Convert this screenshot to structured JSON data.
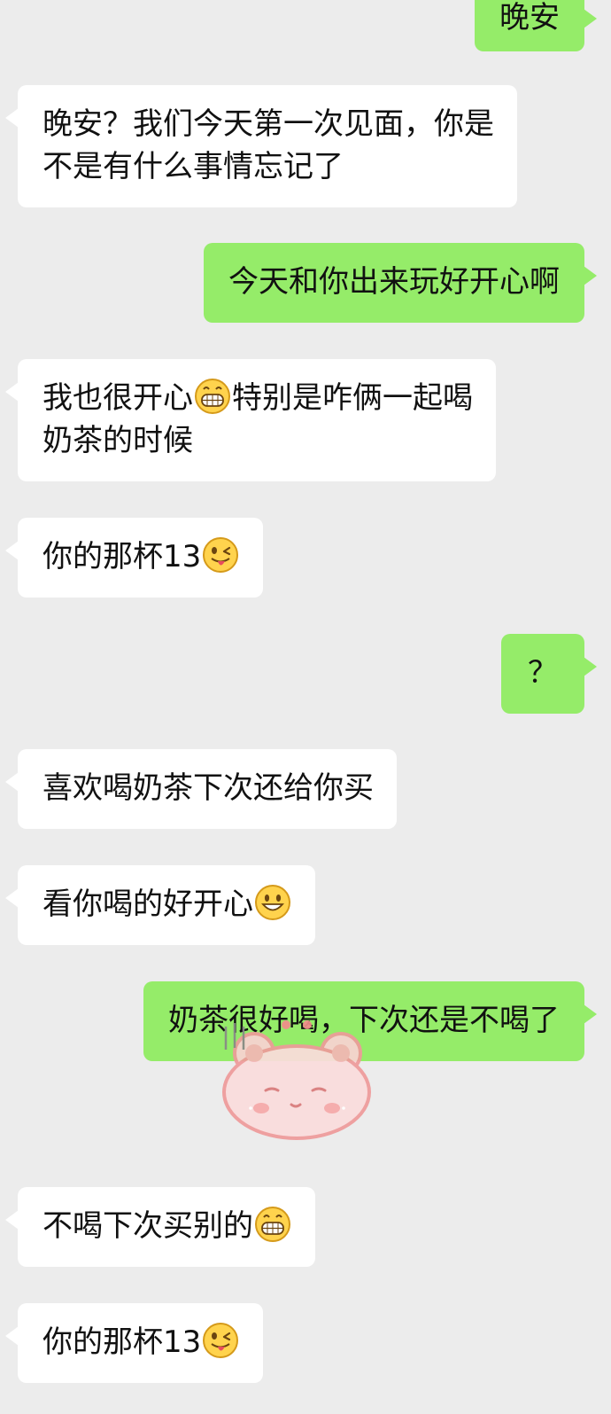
{
  "messages": [
    {
      "id": "m1",
      "side": "out",
      "text": "晚安"
    },
    {
      "id": "m2",
      "side": "in",
      "line1": "晚安？我们今天第一次见面，你是",
      "line2": "不是有什么事情忘记了"
    },
    {
      "id": "m3",
      "side": "out",
      "text": "今天和你出来玩好开心啊"
    },
    {
      "id": "m4",
      "side": "in",
      "line1_a": "我也很开心",
      "line1_b": "特别是咋俩一起喝",
      "line2": "奶茶的时候",
      "emoji": "grinning-face-emoji"
    },
    {
      "id": "m5",
      "side": "in",
      "text": "你的那杯13",
      "emoji": "winking-tongue-face-emoji"
    },
    {
      "id": "m6",
      "side": "out",
      "text": "？"
    },
    {
      "id": "m7",
      "side": "in",
      "text": "喜欢喝奶茶下次还给你买"
    },
    {
      "id": "m8",
      "side": "in",
      "text": "看你喝的好开心",
      "emoji": "smiling-face-emoji"
    },
    {
      "id": "m9",
      "side": "out",
      "text": "奶茶很好喝，下次还是不喝了"
    },
    {
      "id": "m10",
      "side": "in",
      "text": "不喝下次买别的",
      "emoji": "grinning-face-emoji"
    },
    {
      "id": "m11",
      "side": "in",
      "text": "你的那杯13",
      "emoji": "winking-tongue-face-emoji"
    }
  ],
  "sticker": {
    "name": "pink-bear-sticker"
  },
  "colors": {
    "background": "#ececec",
    "incoming_bubble": "#ffffff",
    "outgoing_bubble": "#95ec69",
    "text": "#111111"
  }
}
